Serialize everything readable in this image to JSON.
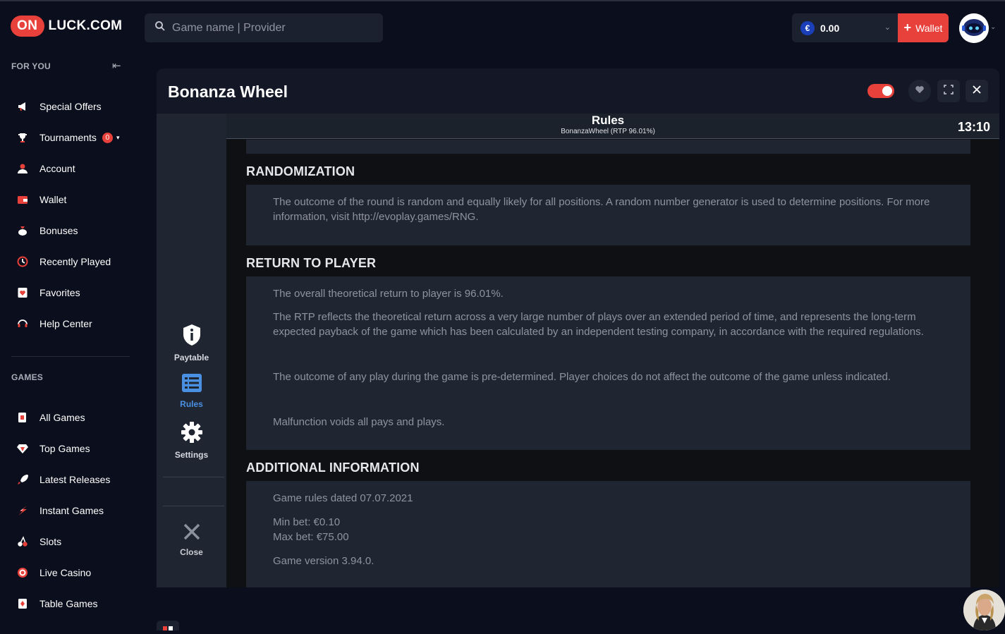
{
  "header": {
    "logo_badge": "ON",
    "logo_text": "LUCK.COM",
    "search_placeholder": "Game name | Provider",
    "currency_symbol": "€",
    "balance": "0.00",
    "wallet_label": "Wallet"
  },
  "sidebar": {
    "for_you_title": "FOR YOU",
    "for_you": [
      {
        "label": "Special Offers",
        "icon": "megaphone-icon"
      },
      {
        "label": "Tournaments",
        "icon": "trophy-icon",
        "badge": "0"
      },
      {
        "label": "Account",
        "icon": "user-icon"
      },
      {
        "label": "Wallet",
        "icon": "wallet-icon"
      },
      {
        "label": "Bonuses",
        "icon": "money-bag-icon"
      },
      {
        "label": "Recently Played",
        "icon": "clock-icon"
      },
      {
        "label": "Favorites",
        "icon": "heart-card-icon"
      },
      {
        "label": "Help Center",
        "icon": "headset-icon"
      }
    ],
    "games_title": "GAMES",
    "games": [
      {
        "label": "All Games",
        "icon": "cards-icon"
      },
      {
        "label": "Top Games",
        "icon": "diamond-icon"
      },
      {
        "label": "Latest Releases",
        "icon": "rocket-icon"
      },
      {
        "label": "Instant Games",
        "icon": "lightning-icon"
      },
      {
        "label": "Slots",
        "icon": "cherries-icon"
      },
      {
        "label": "Live Casino",
        "icon": "chip-icon"
      },
      {
        "label": "Table Games",
        "icon": "playing-card-icon"
      }
    ]
  },
  "game": {
    "title": "Bonanza Wheel",
    "rail": {
      "paytable": "Paytable",
      "rules": "Rules",
      "settings": "Settings",
      "close": "Close"
    },
    "rules_title": "Rules",
    "rules_subtitle": "BonanzaWheel (RTP 96.01%)",
    "clock": "13:10",
    "sections": {
      "randomization": {
        "heading": "RANDOMIZATION",
        "text": "The outcome of the round is random and equally likely for all positions. A random number generator is used to determine positions. For more information, visit http://evoplay.games/RNG."
      },
      "rtp": {
        "heading": "RETURN TO PLAYER",
        "p1": "The overall theoretical return to player is 96.01%.",
        "p2": "The RTP reflects the theoretical return across a very large number of plays over an extended period of time, and represents the long-term expected payback of the game which has been calculated by an independent testing company, in accordance with the required regulations.",
        "p3": "The outcome of any play during the game is pre-determined. Player choices do not affect the outcome of the game unless indicated.",
        "p4": "Malfunction voids all pays and plays."
      },
      "additional": {
        "heading": "ADDITIONAL INFORMATION",
        "p1": "Game rules dated 07.07.2021",
        "p2": "Min bet: €0.10",
        "p3": "Max bet: €75.00",
        "p4": "Game version 3.94.0."
      }
    }
  },
  "colors": {
    "accent": "#e8403a",
    "background": "#0b0e1c",
    "rules_active": "#4a90e2"
  }
}
